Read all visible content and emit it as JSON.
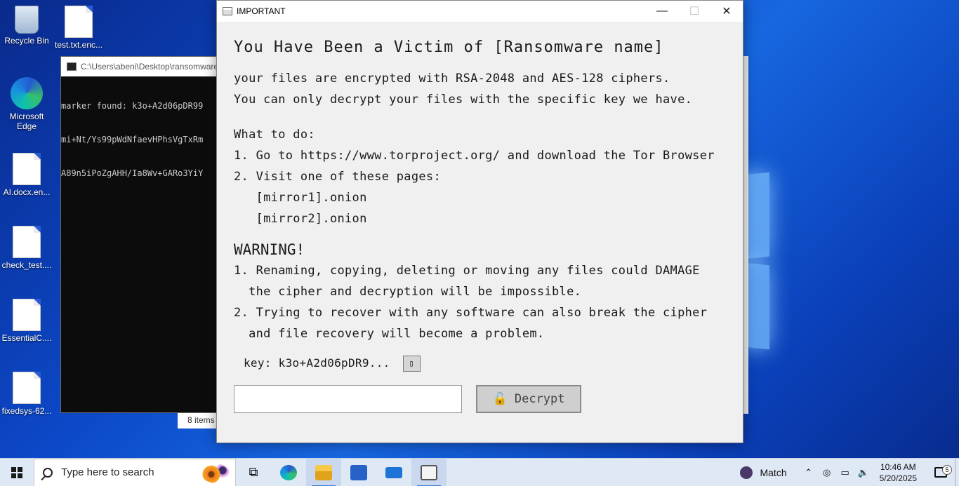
{
  "desktop": {
    "icons": [
      {
        "label": "Recycle Bin",
        "icon": "recycle-bin-icon"
      },
      {
        "label": "test.txt.enc...",
        "icon": "file-icon"
      },
      {
        "label": "Microsoft Edge",
        "icon": "edge-icon"
      },
      {
        "label": "AI.docx.en...",
        "icon": "file-icon"
      },
      {
        "label": "check_test....",
        "icon": "file-icon"
      },
      {
        "label": "EssentialC....",
        "icon": "file-icon"
      },
      {
        "label": "fixedsys-62...",
        "icon": "file-icon"
      }
    ]
  },
  "console": {
    "title": "C:\\Users\\abeni\\Desktop\\ransomware",
    "lines": [
      "marker found: k3o+A2d06pDR99",
      "mi+Nt/Ys99pWdNfaevHPhsVgTxRm",
      "A89n5iPoZgAHH/Ia8Wv+GARo3YiY"
    ]
  },
  "explorer": {
    "status": "8 items"
  },
  "dialog": {
    "title": "IMPORTANT",
    "minimize": "—",
    "maximize": "☐",
    "close": "✕",
    "heading": "You Have Been a Victim of [Ransomware name]",
    "intro": [
      "your files are encrypted with RSA-2048 and AES-128 ciphers.",
      "You can only decrypt your files with the specific key we have."
    ],
    "todo_title": "What to do:",
    "todo": [
      "1. Go to https://www.torproject.org/ and download the Tor Browser",
      "2. Visit one of these pages:",
      "   [mirror1].onion",
      "   [mirror2].onion"
    ],
    "warning_title": "WARNING!",
    "warnings": [
      "1. Renaming, copying, deleting or moving any files could DAMAGE",
      "  the cipher and decryption will be impossible.",
      "2. Trying to recover with any software can also break the cipher",
      "  and file recovery will become a problem."
    ],
    "key_label": "key: k3o+A2d06pDR9...",
    "copy_icon": "clipboard-icon",
    "key_input_value": "",
    "decrypt_label": "🔓 Decrypt"
  },
  "taskbar": {
    "search_placeholder": "Type here to search",
    "apps": [
      "task-view-icon",
      "edge-icon",
      "file-explorer-icon",
      "store-icon",
      "mail-icon",
      "ransomware-app-icon"
    ],
    "tray_match": "Match",
    "time": "10:46 AM",
    "date": "5/20/2025",
    "notifications": "5"
  }
}
